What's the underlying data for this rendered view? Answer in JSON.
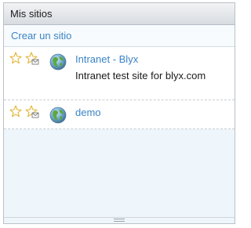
{
  "dashlet": {
    "title": "Mis sitios",
    "create_link": "Crear un sitio"
  },
  "sites": [
    {
      "name": "Intranet - Blyx",
      "description": "Intranet test site for blyx.com",
      "favourite": false,
      "imap_favourite": true
    },
    {
      "name": "demo",
      "description": "",
      "favourite": false,
      "imap_favourite": true
    }
  ],
  "icons": {
    "favourite": "star-icon",
    "imap_favourite": "star-envelope-icon",
    "site": "globe-icon",
    "resize": "resize-grip-icon"
  },
  "colors": {
    "link": "#3b84c5",
    "star_outline": "#e2b637",
    "panel_bg": "#eef6fb"
  }
}
